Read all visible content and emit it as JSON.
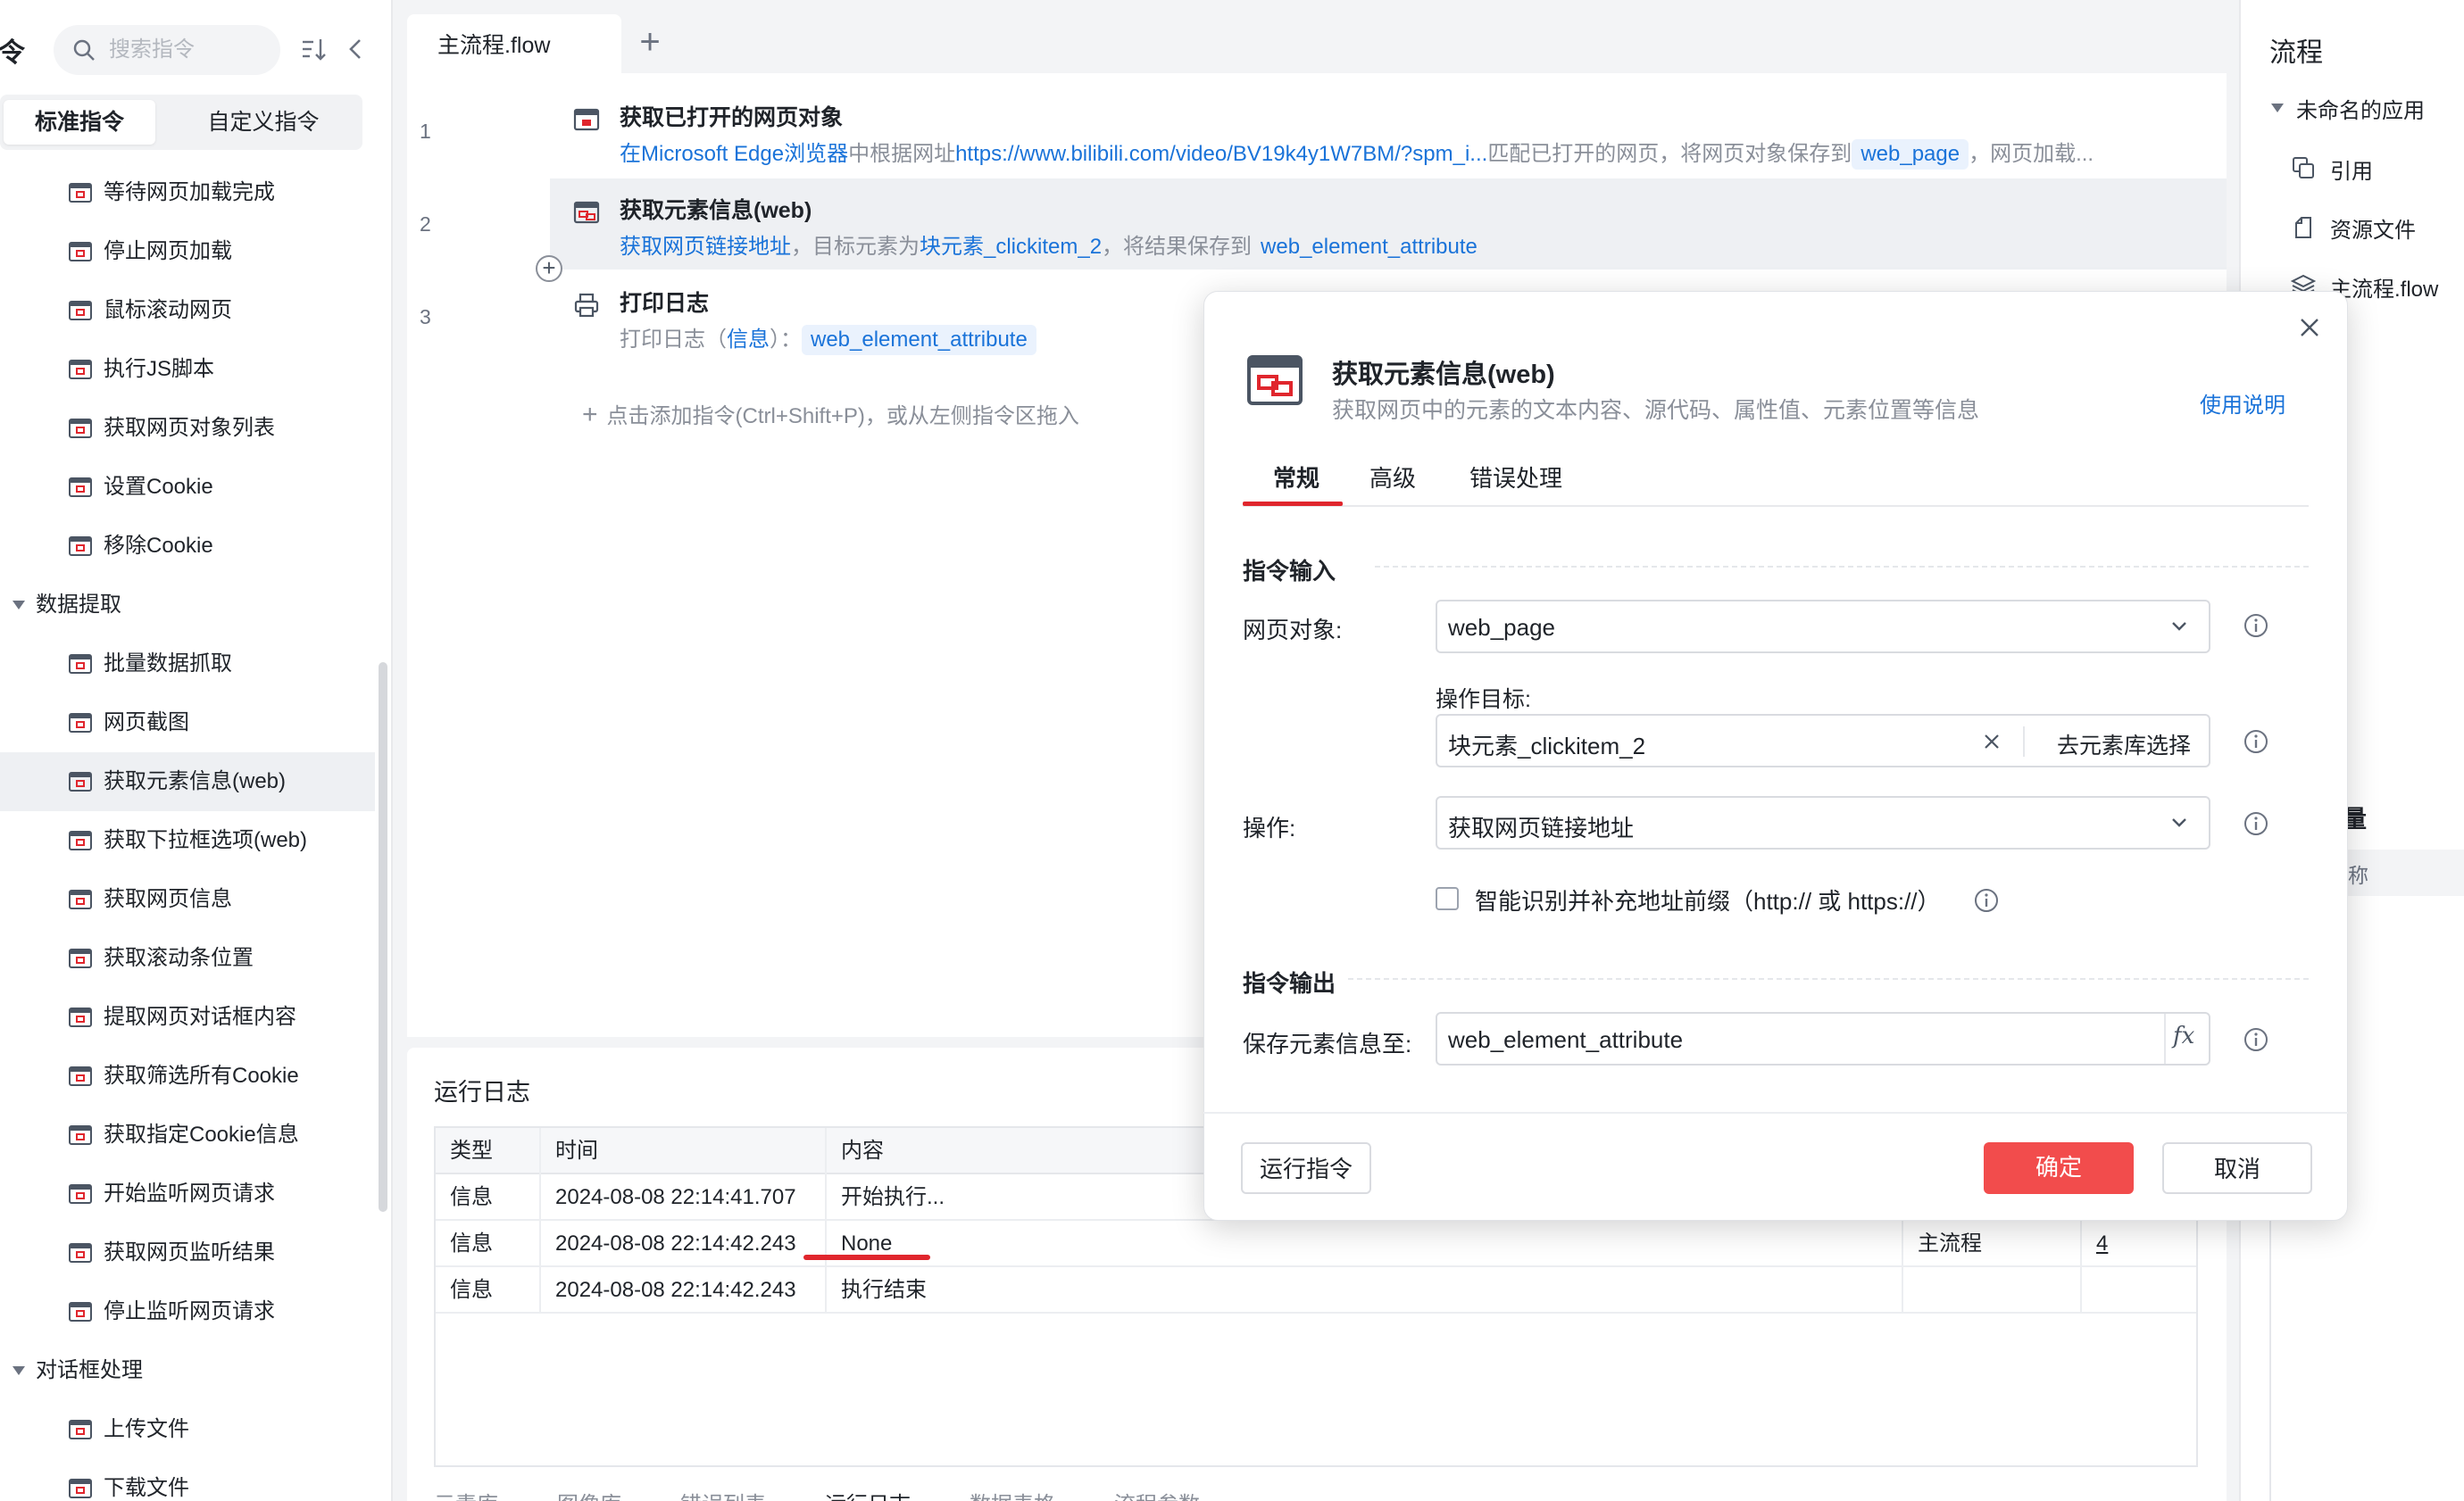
{
  "sidebar": {
    "title": "令",
    "search_placeholder": "搜索指令",
    "tabs": {
      "standard": "标准指令",
      "custom": "自定义指令"
    },
    "items": [
      {
        "label": "等待网页加载完成",
        "icon": "browser-wait-icon",
        "type": "item"
      },
      {
        "label": "停止网页加载",
        "icon": "browser-stop-icon",
        "type": "item"
      },
      {
        "label": "鼠标滚动网页",
        "icon": "browser-scroll-icon",
        "type": "item"
      },
      {
        "label": "执行JS脚本",
        "icon": "js-script-icon",
        "type": "item"
      },
      {
        "label": "获取网页对象列表",
        "icon": "browser-list-icon",
        "type": "item"
      },
      {
        "label": "设置Cookie",
        "icon": "cookie-set-icon",
        "type": "item"
      },
      {
        "label": "移除Cookie",
        "icon": "cookie-remove-icon",
        "type": "item"
      },
      {
        "label": "数据提取",
        "type": "group"
      },
      {
        "label": "批量数据抓取",
        "icon": "batch-extract-icon",
        "type": "item"
      },
      {
        "label": "网页截图",
        "icon": "screenshot-icon",
        "type": "item"
      },
      {
        "label": "获取元素信息(web)",
        "icon": "element-info-icon",
        "type": "item",
        "selected": true
      },
      {
        "label": "获取下拉框选项(web)",
        "icon": "dropdown-options-icon",
        "type": "item"
      },
      {
        "label": "获取网页信息",
        "icon": "page-info-icon",
        "type": "item"
      },
      {
        "label": "获取滚动条位置",
        "icon": "scroll-position-icon",
        "type": "item"
      },
      {
        "label": "提取网页对话框内容",
        "icon": "dialog-content-icon",
        "type": "item"
      },
      {
        "label": "获取筛选所有Cookie",
        "icon": "cookie-filter-icon",
        "type": "item"
      },
      {
        "label": "获取指定Cookie信息",
        "icon": "cookie-info-icon",
        "type": "item"
      },
      {
        "label": "开始监听网页请求",
        "icon": "listen-start-icon",
        "type": "item"
      },
      {
        "label": "获取网页监听结果",
        "icon": "listen-result-icon",
        "type": "item"
      },
      {
        "label": "停止监听网页请求",
        "icon": "listen-stop-icon",
        "type": "item"
      },
      {
        "label": "对话框处理",
        "type": "group"
      },
      {
        "label": "上传文件",
        "icon": "upload-file-icon",
        "type": "item"
      },
      {
        "label": "下载文件",
        "icon": "download-file-icon",
        "type": "item"
      }
    ]
  },
  "editor": {
    "file_tab": "主流程.flow",
    "steps": [
      {
        "line": "1",
        "title": "获取已打开的网页对象",
        "desc_parts": {
          "p1": "在",
          "p2": "Microsoft Edge浏览器",
          "p3": "中根据网址",
          "p4": "https://www.bilibili.com/video/BV19k4y1W7BM/?spm_i...",
          "p5": "匹配已打开的网页，将网页对象保存到",
          "var": "web_page",
          "p6": "，网页加载..."
        }
      },
      {
        "line": "2",
        "title": "获取元素信息(web)",
        "desc_parts": {
          "p1": "获取网页链接地址",
          "p2": "，目标元素为",
          "p3": "块元素_clickitem_2",
          "p4": "，将结果保存到",
          "var": "web_element_attribute"
        }
      },
      {
        "line": "3",
        "title": "打印日志",
        "desc_parts": {
          "p1": "打印日志（",
          "p2": "信息",
          "p3": "）：",
          "var": "web_element_attribute"
        }
      }
    ],
    "add_hint": "点击添加指令(Ctrl+Shift+P)，或从左侧指令区拖入"
  },
  "log": {
    "title": "运行日志",
    "columns": [
      "类型",
      "时间",
      "内容"
    ],
    "rows": [
      {
        "type": "信息",
        "time": "2024-08-08 22:14:41.707",
        "content": "开始执行..."
      },
      {
        "type": "信息",
        "time": "2024-08-08 22:14:42.243",
        "content": "None",
        "source": "主流程",
        "line": "4"
      },
      {
        "type": "信息",
        "time": "2024-08-08 22:14:42.243",
        "content": "执行结束"
      }
    ],
    "bottom_tabs": [
      "元素库",
      "图像库",
      "错误列表",
      "运行日志",
      "数据表格",
      "流程参数"
    ]
  },
  "right_panel": {
    "title": "流程",
    "app_name": "未命名的应用",
    "items": [
      {
        "label": "引用",
        "icon": "reference-icon"
      },
      {
        "label": "资源文件",
        "icon": "resource-file-icon"
      },
      {
        "label": "主流程.flow",
        "icon": "flow-layers-icon"
      }
    ],
    "vars_title": "量",
    "vars_name_col": "称"
  },
  "modal": {
    "title": "获取元素信息(web)",
    "description": "获取网页中的元素的文本内容、源代码、属性值、元素位置等信息",
    "help": "使用说明",
    "tabs": [
      "常规",
      "高级",
      "错误处理"
    ],
    "input_section": "指令输入",
    "output_section": "指令输出",
    "fields": {
      "page_label": "网页对象:",
      "page_value": "web_page",
      "target_label": "操作目标:",
      "target_value": "块元素_clickitem_2",
      "target_lib": "去元素库选择",
      "op_label": "操作:",
      "op_value": "获取网页链接地址",
      "checkbox_label": "智能识别并补充地址前缀（http:// 或 https://）",
      "checkbox_checked": false,
      "save_label": "保存元素信息至:",
      "save_value": "web_element_attribute",
      "fx": "fx"
    },
    "buttons": {
      "run": "运行指令",
      "ok": "确定",
      "cancel": "取消"
    }
  },
  "colors": {
    "accent_red": "#e0262d",
    "primary_button": "#f24c4c",
    "link_blue": "#1a73d9"
  }
}
